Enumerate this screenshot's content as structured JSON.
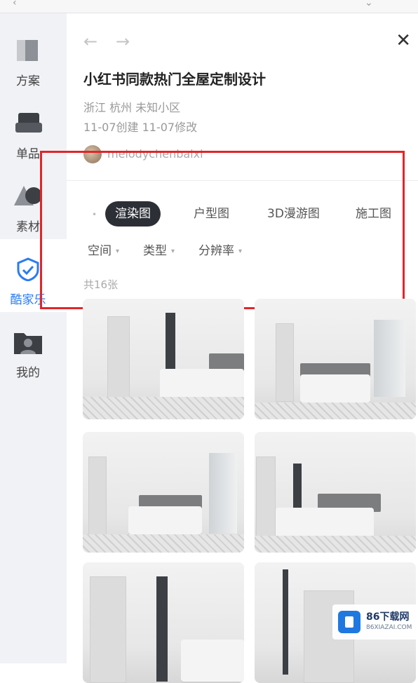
{
  "sidebar": {
    "items": [
      {
        "label": "方案",
        "icon": "scheme-icon"
      },
      {
        "label": "单品",
        "icon": "sofa-icon"
      },
      {
        "label": "素材",
        "icon": "shapes-icon"
      },
      {
        "label": "酷家乐",
        "icon": "kujiale-shield-icon"
      },
      {
        "label": "我的",
        "icon": "user-folder-icon"
      }
    ],
    "active_index": 3
  },
  "header": {
    "back_icon": "←",
    "forward_icon": "→",
    "close_icon": "✕"
  },
  "project": {
    "title": "小红书同款热门全屋定制设计",
    "location": "浙江 杭州 未知小区",
    "dates": "11-07创建  11-07修改",
    "author": "melodychenbaixi"
  },
  "tabs": [
    {
      "label": "渲染图",
      "active": true
    },
    {
      "label": "户型图",
      "active": false
    },
    {
      "label": "3D漫游图",
      "active": false
    },
    {
      "label": "施工图",
      "active": false
    }
  ],
  "filters": [
    {
      "label": "空间"
    },
    {
      "label": "类型"
    },
    {
      "label": "分辨率"
    }
  ],
  "image_count": "共16张",
  "watermark": {
    "title": "86下载网",
    "url": "86XIAZAI.COM"
  },
  "colors": {
    "accent_blue": "#2a7bf4",
    "active_tab_bg": "#2c2f36",
    "highlight_box": "#e0262a"
  }
}
